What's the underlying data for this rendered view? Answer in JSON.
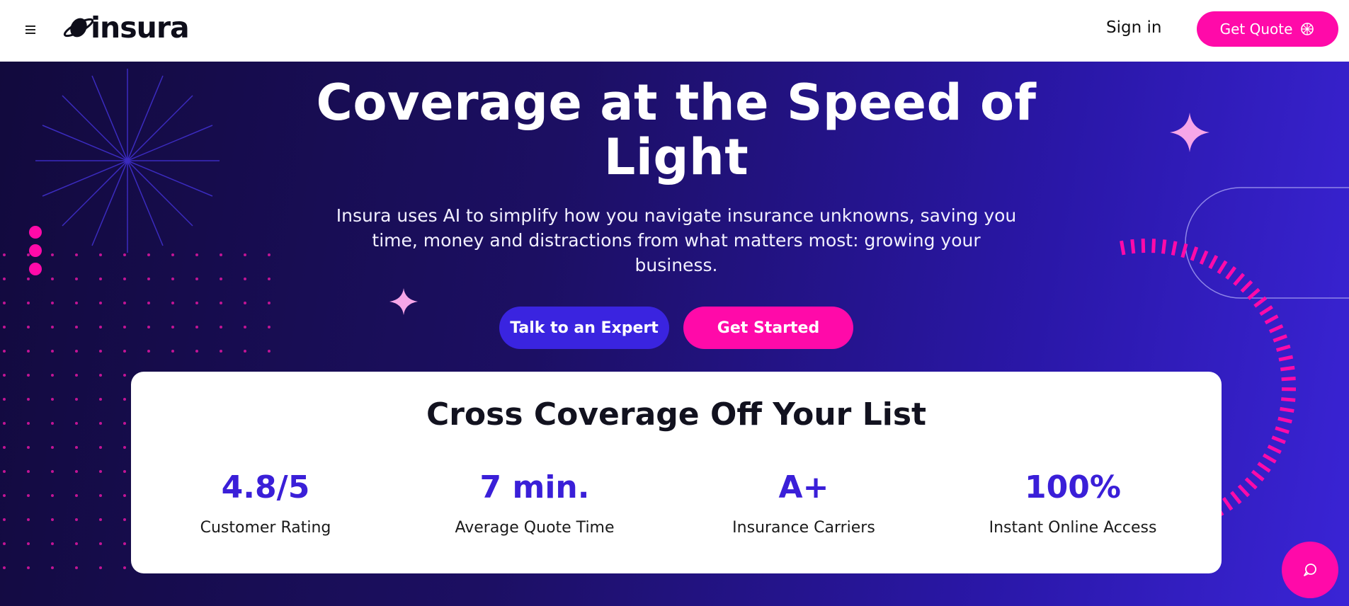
{
  "header": {
    "brand_name": "insura",
    "sign_in_label": "Sign in",
    "get_quote_label": "Get Quote"
  },
  "hero": {
    "title": "Coverage at the Speed of Light",
    "subtitle": "Insura uses AI to simplify how you navigate insurance unknowns, saving you time, money and distractions from what matters most: growing your business.",
    "expert_button_label": "Talk to an Expert",
    "get_started_label": "Get Started"
  },
  "stats": {
    "title": "Cross Coverage Off Your List",
    "items": [
      {
        "value": "4.8/5",
        "label": "Customer Rating"
      },
      {
        "value": "7 min.",
        "label": "Average Quote Time"
      },
      {
        "value": "A+",
        "label": "Insurance Carriers"
      },
      {
        "value": "100%",
        "label": "Instant Online Access"
      }
    ]
  },
  "colors": {
    "accent_pink": "#ff0aa9",
    "accent_blue": "#3a24e0",
    "stat_value": "#3a1fd8"
  },
  "icons": {
    "menu": "menu-icon",
    "logo": "planet-logo-icon",
    "quote": "sparkle-ai-icon",
    "chat": "chat-bubble-icon"
  }
}
